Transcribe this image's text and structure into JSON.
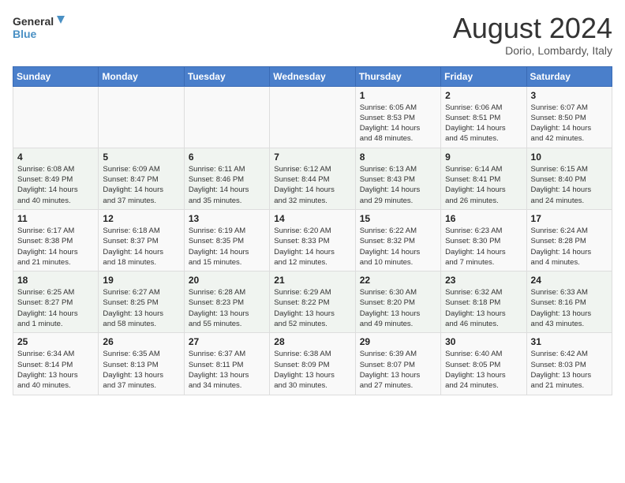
{
  "header": {
    "logo_line1": "General",
    "logo_line2": "Blue",
    "main_title": "August 2024",
    "subtitle": "Dorio, Lombardy, Italy"
  },
  "days_of_week": [
    "Sunday",
    "Monday",
    "Tuesday",
    "Wednesday",
    "Thursday",
    "Friday",
    "Saturday"
  ],
  "weeks": [
    [
      {
        "day": "",
        "info": ""
      },
      {
        "day": "",
        "info": ""
      },
      {
        "day": "",
        "info": ""
      },
      {
        "day": "",
        "info": ""
      },
      {
        "day": "1",
        "info": "Sunrise: 6:05 AM\nSunset: 8:53 PM\nDaylight: 14 hours\nand 48 minutes."
      },
      {
        "day": "2",
        "info": "Sunrise: 6:06 AM\nSunset: 8:51 PM\nDaylight: 14 hours\nand 45 minutes."
      },
      {
        "day": "3",
        "info": "Sunrise: 6:07 AM\nSunset: 8:50 PM\nDaylight: 14 hours\nand 42 minutes."
      }
    ],
    [
      {
        "day": "4",
        "info": "Sunrise: 6:08 AM\nSunset: 8:49 PM\nDaylight: 14 hours\nand 40 minutes."
      },
      {
        "day": "5",
        "info": "Sunrise: 6:09 AM\nSunset: 8:47 PM\nDaylight: 14 hours\nand 37 minutes."
      },
      {
        "day": "6",
        "info": "Sunrise: 6:11 AM\nSunset: 8:46 PM\nDaylight: 14 hours\nand 35 minutes."
      },
      {
        "day": "7",
        "info": "Sunrise: 6:12 AM\nSunset: 8:44 PM\nDaylight: 14 hours\nand 32 minutes."
      },
      {
        "day": "8",
        "info": "Sunrise: 6:13 AM\nSunset: 8:43 PM\nDaylight: 14 hours\nand 29 minutes."
      },
      {
        "day": "9",
        "info": "Sunrise: 6:14 AM\nSunset: 8:41 PM\nDaylight: 14 hours\nand 26 minutes."
      },
      {
        "day": "10",
        "info": "Sunrise: 6:15 AM\nSunset: 8:40 PM\nDaylight: 14 hours\nand 24 minutes."
      }
    ],
    [
      {
        "day": "11",
        "info": "Sunrise: 6:17 AM\nSunset: 8:38 PM\nDaylight: 14 hours\nand 21 minutes."
      },
      {
        "day": "12",
        "info": "Sunrise: 6:18 AM\nSunset: 8:37 PM\nDaylight: 14 hours\nand 18 minutes."
      },
      {
        "day": "13",
        "info": "Sunrise: 6:19 AM\nSunset: 8:35 PM\nDaylight: 14 hours\nand 15 minutes."
      },
      {
        "day": "14",
        "info": "Sunrise: 6:20 AM\nSunset: 8:33 PM\nDaylight: 14 hours\nand 12 minutes."
      },
      {
        "day": "15",
        "info": "Sunrise: 6:22 AM\nSunset: 8:32 PM\nDaylight: 14 hours\nand 10 minutes."
      },
      {
        "day": "16",
        "info": "Sunrise: 6:23 AM\nSunset: 8:30 PM\nDaylight: 14 hours\nand 7 minutes."
      },
      {
        "day": "17",
        "info": "Sunrise: 6:24 AM\nSunset: 8:28 PM\nDaylight: 14 hours\nand 4 minutes."
      }
    ],
    [
      {
        "day": "18",
        "info": "Sunrise: 6:25 AM\nSunset: 8:27 PM\nDaylight: 14 hours\nand 1 minute."
      },
      {
        "day": "19",
        "info": "Sunrise: 6:27 AM\nSunset: 8:25 PM\nDaylight: 13 hours\nand 58 minutes."
      },
      {
        "day": "20",
        "info": "Sunrise: 6:28 AM\nSunset: 8:23 PM\nDaylight: 13 hours\nand 55 minutes."
      },
      {
        "day": "21",
        "info": "Sunrise: 6:29 AM\nSunset: 8:22 PM\nDaylight: 13 hours\nand 52 minutes."
      },
      {
        "day": "22",
        "info": "Sunrise: 6:30 AM\nSunset: 8:20 PM\nDaylight: 13 hours\nand 49 minutes."
      },
      {
        "day": "23",
        "info": "Sunrise: 6:32 AM\nSunset: 8:18 PM\nDaylight: 13 hours\nand 46 minutes."
      },
      {
        "day": "24",
        "info": "Sunrise: 6:33 AM\nSunset: 8:16 PM\nDaylight: 13 hours\nand 43 minutes."
      }
    ],
    [
      {
        "day": "25",
        "info": "Sunrise: 6:34 AM\nSunset: 8:14 PM\nDaylight: 13 hours\nand 40 minutes."
      },
      {
        "day": "26",
        "info": "Sunrise: 6:35 AM\nSunset: 8:13 PM\nDaylight: 13 hours\nand 37 minutes."
      },
      {
        "day": "27",
        "info": "Sunrise: 6:37 AM\nSunset: 8:11 PM\nDaylight: 13 hours\nand 34 minutes."
      },
      {
        "day": "28",
        "info": "Sunrise: 6:38 AM\nSunset: 8:09 PM\nDaylight: 13 hours\nand 30 minutes."
      },
      {
        "day": "29",
        "info": "Sunrise: 6:39 AM\nSunset: 8:07 PM\nDaylight: 13 hours\nand 27 minutes."
      },
      {
        "day": "30",
        "info": "Sunrise: 6:40 AM\nSunset: 8:05 PM\nDaylight: 13 hours\nand 24 minutes."
      },
      {
        "day": "31",
        "info": "Sunrise: 6:42 AM\nSunset: 8:03 PM\nDaylight: 13 hours\nand 21 minutes."
      }
    ]
  ]
}
